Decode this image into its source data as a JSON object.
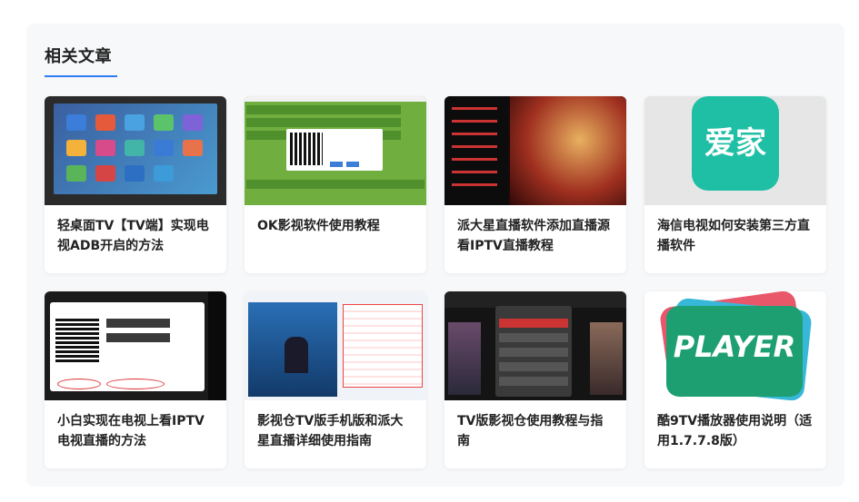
{
  "section": {
    "title": "相关文章"
  },
  "colors": {
    "accent": "#2f7cf6",
    "panel_bg": "#f7f8fa"
  },
  "articles": [
    {
      "title": "轻桌面TV【TV端】实现电视ADB开启的方法"
    },
    {
      "title": "OK影视软件使用教程"
    },
    {
      "title": "派大星直播软件添加直播源看IPTV直播教程"
    },
    {
      "title": "海信电视如何安装第三方直播软件"
    },
    {
      "title": "小白实现在电视上看IPTV电视直播的方法"
    },
    {
      "title": "影视仓TV版手机版和派大星直播详细使用指南"
    },
    {
      "title": "TV版影视仓使用教程与指南"
    },
    {
      "title": "酷9TV播放器使用说明（适用1.7.7.8版）"
    }
  ],
  "thumbs": {
    "aijia_text": "爱家",
    "player_text": "PLAYER"
  }
}
